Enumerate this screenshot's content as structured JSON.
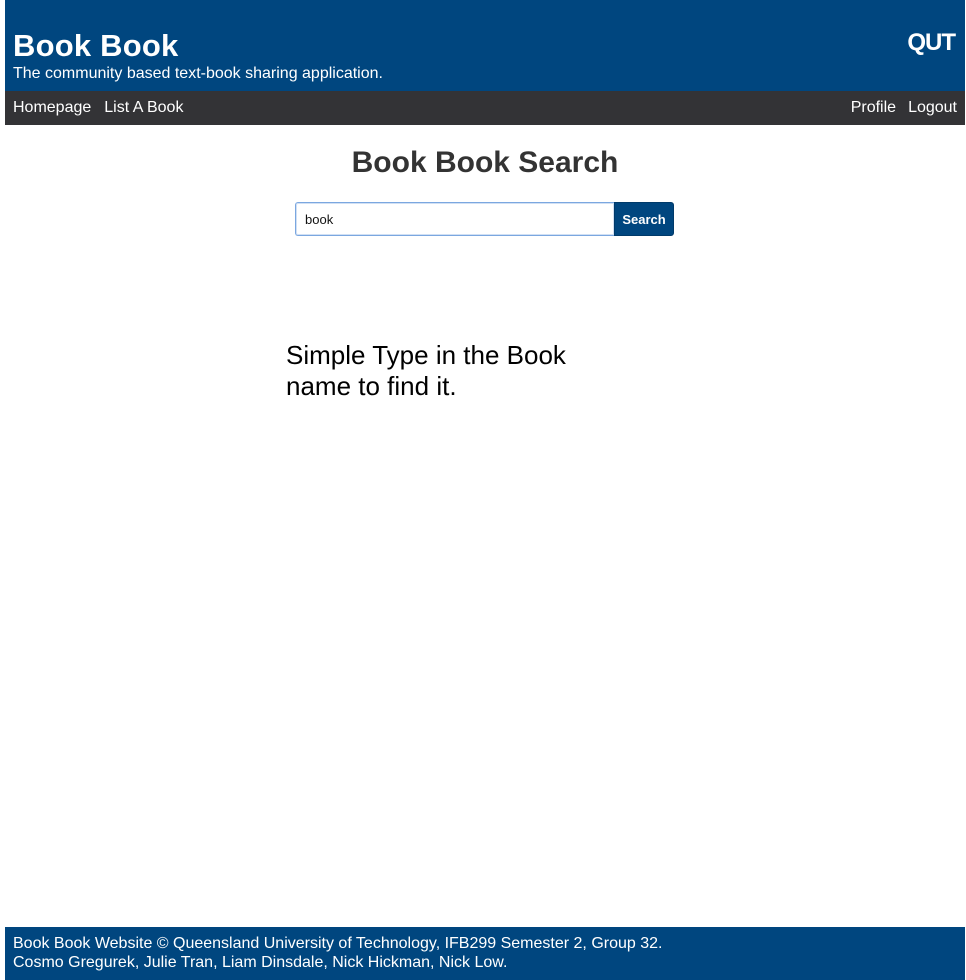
{
  "header": {
    "title": "Book Book",
    "tagline": "The community based text-book sharing application.",
    "logo_text": "QUT"
  },
  "nav": {
    "left": [
      {
        "label": "Homepage"
      },
      {
        "label": "List A Book"
      }
    ],
    "right": [
      {
        "label": "Profile"
      },
      {
        "label": "Logout"
      }
    ]
  },
  "search": {
    "title": "Book Book Search",
    "input_value": "book",
    "button_label": "Search"
  },
  "main": {
    "help_text": "Simple Type in the Book name to find it."
  },
  "footer": {
    "line1": "Book Book Website © Queensland University of Technology, IFB299 Semester 2, Group 32.",
    "line2": "Cosmo Gregurek, Julie Tran, Liam Dinsdale, Nick Hickman, Nick Low."
  },
  "colors": {
    "brand_blue": "#00467f",
    "nav_dark": "#333336",
    "input_focus_border": "#7ba7e0"
  }
}
